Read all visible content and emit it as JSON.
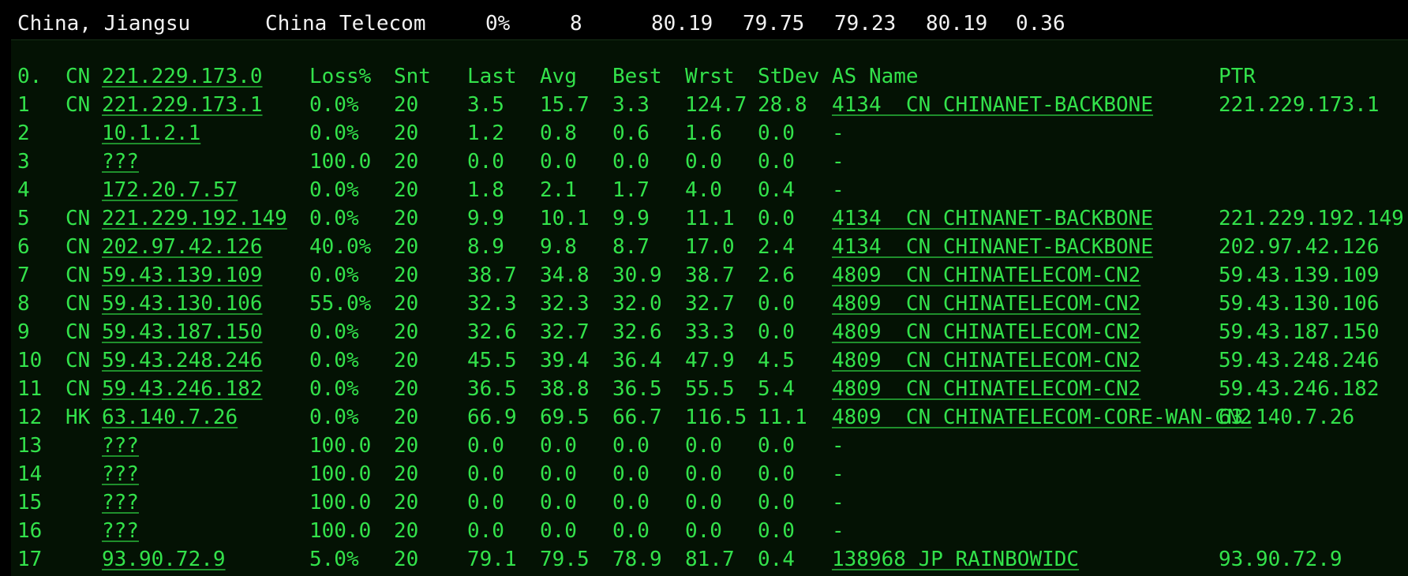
{
  "summary": {
    "location": "China, Jiangsu",
    "isp": "China Telecom",
    "loss": "0%",
    "count": "8",
    "v1": "80.19",
    "v2": "79.75",
    "v3": "79.23",
    "v4": "80.19",
    "v5": "0.36"
  },
  "header": {
    "hop": "0.",
    "cc": "CN",
    "host": "221.229.173.0",
    "loss": "Loss%",
    "snt": "Snt",
    "last": "Last",
    "avg": "Avg",
    "best": "Best",
    "wrst": "Wrst",
    "stdev": "StDev",
    "as_name": "AS Name",
    "ptr": "PTR"
  },
  "hops": [
    {
      "hop": "1",
      "cc": "CN",
      "host": "221.229.173.1",
      "loss": "0.0%",
      "snt": "20",
      "last": "3.5",
      "avg": "15.7",
      "best": "3.3",
      "wrst": "124.7",
      "stdev": "28.8",
      "as_name": "4134  CN CHINANET-BACKBONE",
      "ptr": "221.229.173.1"
    },
    {
      "hop": "2",
      "cc": "",
      "host": "10.1.2.1",
      "loss": "0.0%",
      "snt": "20",
      "last": "1.2",
      "avg": "0.8",
      "best": "0.6",
      "wrst": "1.6",
      "stdev": "0.0",
      "as_name": "-",
      "ptr": ""
    },
    {
      "hop": "3",
      "cc": "",
      "host": "???",
      "loss": "100.0",
      "snt": "20",
      "last": "0.0",
      "avg": "0.0",
      "best": "0.0",
      "wrst": "0.0",
      "stdev": "0.0",
      "as_name": "-",
      "ptr": ""
    },
    {
      "hop": "4",
      "cc": "",
      "host": "172.20.7.57",
      "loss": "0.0%",
      "snt": "20",
      "last": "1.8",
      "avg": "2.1",
      "best": "1.7",
      "wrst": "4.0",
      "stdev": "0.4",
      "as_name": "-",
      "ptr": ""
    },
    {
      "hop": "5",
      "cc": "CN",
      "host": "221.229.192.149",
      "loss": "0.0%",
      "snt": "20",
      "last": "9.9",
      "avg": "10.1",
      "best": "9.9",
      "wrst": "11.1",
      "stdev": "0.0",
      "as_name": "4134  CN CHINANET-BACKBONE",
      "ptr": "221.229.192.149"
    },
    {
      "hop": "6",
      "cc": "CN",
      "host": "202.97.42.126",
      "loss": "40.0%",
      "snt": "20",
      "last": "8.9",
      "avg": "9.8",
      "best": "8.7",
      "wrst": "17.0",
      "stdev": "2.4",
      "as_name": "4134  CN CHINANET-BACKBONE",
      "ptr": "202.97.42.126"
    },
    {
      "hop": "7",
      "cc": "CN",
      "host": "59.43.139.109",
      "loss": "0.0%",
      "snt": "20",
      "last": "38.7",
      "avg": "34.8",
      "best": "30.9",
      "wrst": "38.7",
      "stdev": "2.6",
      "as_name": "4809  CN CHINATELECOM-CN2",
      "ptr": "59.43.139.109"
    },
    {
      "hop": "8",
      "cc": "CN",
      "host": "59.43.130.106",
      "loss": "55.0%",
      "snt": "20",
      "last": "32.3",
      "avg": "32.3",
      "best": "32.0",
      "wrst": "32.7",
      "stdev": "0.0",
      "as_name": "4809  CN CHINATELECOM-CN2",
      "ptr": "59.43.130.106"
    },
    {
      "hop": "9",
      "cc": "CN",
      "host": "59.43.187.150",
      "loss": "0.0%",
      "snt": "20",
      "last": "32.6",
      "avg": "32.7",
      "best": "32.6",
      "wrst": "33.3",
      "stdev": "0.0",
      "as_name": "4809  CN CHINATELECOM-CN2",
      "ptr": "59.43.187.150"
    },
    {
      "hop": "10",
      "cc": "CN",
      "host": "59.43.248.246",
      "loss": "0.0%",
      "snt": "20",
      "last": "45.5",
      "avg": "39.4",
      "best": "36.4",
      "wrst": "47.9",
      "stdev": "4.5",
      "as_name": "4809  CN CHINATELECOM-CN2",
      "ptr": "59.43.248.246"
    },
    {
      "hop": "11",
      "cc": "CN",
      "host": "59.43.246.182",
      "loss": "0.0%",
      "snt": "20",
      "last": "36.5",
      "avg": "38.8",
      "best": "36.5",
      "wrst": "55.5",
      "stdev": "5.4",
      "as_name": "4809  CN CHINATELECOM-CN2",
      "ptr": "59.43.246.182"
    },
    {
      "hop": "12",
      "cc": "HK",
      "host": "63.140.7.26",
      "loss": "0.0%",
      "snt": "20",
      "last": "66.9",
      "avg": "69.5",
      "best": "66.7",
      "wrst": "116.5",
      "stdev": "11.1",
      "as_name": "4809  CN CHINATELECOM-CORE-WAN-CN2",
      "ptr": "63.140.7.26"
    },
    {
      "hop": "13",
      "cc": "",
      "host": "???",
      "loss": "100.0",
      "snt": "20",
      "last": "0.0",
      "avg": "0.0",
      "best": "0.0",
      "wrst": "0.0",
      "stdev": "0.0",
      "as_name": "-",
      "ptr": ""
    },
    {
      "hop": "14",
      "cc": "",
      "host": "???",
      "loss": "100.0",
      "snt": "20",
      "last": "0.0",
      "avg": "0.0",
      "best": "0.0",
      "wrst": "0.0",
      "stdev": "0.0",
      "as_name": "-",
      "ptr": ""
    },
    {
      "hop": "15",
      "cc": "",
      "host": "???",
      "loss": "100.0",
      "snt": "20",
      "last": "0.0",
      "avg": "0.0",
      "best": "0.0",
      "wrst": "0.0",
      "stdev": "0.0",
      "as_name": "-",
      "ptr": ""
    },
    {
      "hop": "16",
      "cc": "",
      "host": "???",
      "loss": "100.0",
      "snt": "20",
      "last": "0.0",
      "avg": "0.0",
      "best": "0.0",
      "wrst": "0.0",
      "stdev": "0.0",
      "as_name": "-",
      "ptr": ""
    },
    {
      "hop": "17",
      "cc": "",
      "host": "93.90.72.9",
      "loss": "5.0%",
      "snt": "20",
      "last": "79.1",
      "avg": "79.5",
      "best": "78.9",
      "wrst": "81.7",
      "stdev": "0.4",
      "as_name": "138968 JP RAINBOWIDC",
      "ptr": "93.90.72.9"
    }
  ],
  "colors": {
    "text_green": "#33e24b",
    "summary_text": "#f2f2f2",
    "panel_bg": "#041204",
    "page_bg": "#000000"
  }
}
